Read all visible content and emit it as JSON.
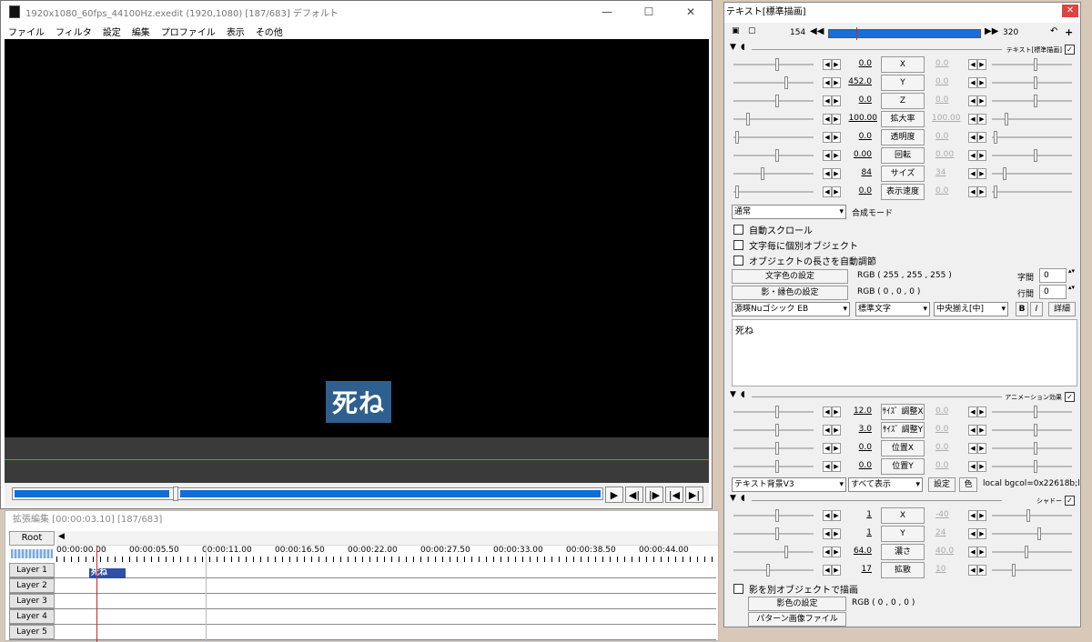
{
  "main_window": {
    "title": "1920x1080_60fps_44100Hz.exedit (1920,1080)  [187/683]  デフォルト",
    "minimize": "—",
    "maximize": "☐",
    "close": "✕",
    "menu": [
      "ファイル",
      "フィルタ",
      "設定",
      "編集",
      "プロファイル",
      "表示",
      "その他"
    ],
    "caption_text": "死ね"
  },
  "playback": {
    "play": "▶",
    "prev_frame": "◀|",
    "next_frame": "|▶",
    "to_start": "|◀",
    "to_end": "▶|"
  },
  "timeline": {
    "title": "拡張編集 [00:00:03.10] [187/683]",
    "root": "Root",
    "scroll_arrow": "◀",
    "ticks": [
      "00:00:00.00",
      "00:00:05.50",
      "00:00:11.00",
      "00:00:16.50",
      "00:00:22.00",
      "00:00:27.50",
      "00:00:33.00",
      "00:00:38.50",
      "00:00:44.00"
    ],
    "layers": [
      "Layer 1",
      "Layer 2",
      "Layer 3",
      "Layer 4",
      "Layer 5"
    ],
    "clip_text": "死ね"
  },
  "panel": {
    "title": "テキスト[標準描画]",
    "close": "✕",
    "frame_start": "154",
    "frame_end": "320",
    "section_text": "テキスト[標準描画]",
    "params": [
      {
        "name": "X",
        "left": "0.0",
        "right": "0.0"
      },
      {
        "name": "Y",
        "left": "452.0",
        "right": "0.0"
      },
      {
        "name": "Z",
        "left": "0.0",
        "right": "0.0"
      },
      {
        "name": "拡大率",
        "left": "100.00",
        "right": "100.00"
      },
      {
        "name": "透明度",
        "left": "0.0",
        "right": "0.0"
      },
      {
        "name": "回転",
        "left": "0.00",
        "right": "0.00"
      },
      {
        "name": "サイズ",
        "left": "84",
        "right": "34"
      },
      {
        "name": "表示速度",
        "left": "0.0",
        "right": "0.0"
      }
    ],
    "blend_mode": "通常",
    "blend_label": "合成モード",
    "checks": [
      "自動スクロール",
      "文字毎に個別オブジェクト",
      "オブジェクトの長さを自動調節"
    ],
    "text_color_btn": "文字色の設定",
    "text_color_value": "RGB ( 255 , 255 , 255 )",
    "shadow_color_btn": "影・縁色の設定",
    "shadow_color_value": "RGB ( 0 , 0 , 0 )",
    "char_spacing_label": "字間",
    "char_spacing": "0",
    "line_spacing_label": "行間",
    "line_spacing": "0",
    "font": "源暎Nuゴシック EB",
    "style": "標準文字",
    "align": "中央揃え[中]",
    "bold": "B",
    "italic": "I",
    "detail": "詳細",
    "text_content": "死ね",
    "anim_section": "アニメーション効果",
    "anim_params": [
      {
        "name": "ｻｲｽﾞ 調整X",
        "left": "12.0",
        "right": "0.0"
      },
      {
        "name": "ｻｲｽﾞ 調整Y",
        "left": "3.0",
        "right": "0.0"
      },
      {
        "name": "位置X",
        "left": "0.0",
        "right": "0.0"
      },
      {
        "name": "位置Y",
        "left": "0.0",
        "right": "0.0"
      }
    ],
    "anim_type": "テキスト背景V3",
    "anim_display": "すべて表示",
    "anim_setting_btn": "設定",
    "anim_color_btn": "色",
    "anim_code": "local bgcol=0x22618b;local",
    "shadow_section": "シャドー",
    "shadow_params": [
      {
        "name": "X",
        "left": "1",
        "right": "-40"
      },
      {
        "name": "Y",
        "left": "1",
        "right": "24"
      },
      {
        "name": "濃さ",
        "left": "64.0",
        "right": "40.0"
      },
      {
        "name": "拡散",
        "left": "17",
        "right": "10"
      }
    ],
    "shadow_separate": "影を別オブジェクトで描画",
    "shadow_color_btn2": "影色の設定",
    "shadow_color_value2": "RGB ( 0 , 0 , 0 )",
    "pattern_btn": "パターン画像ファイル"
  }
}
